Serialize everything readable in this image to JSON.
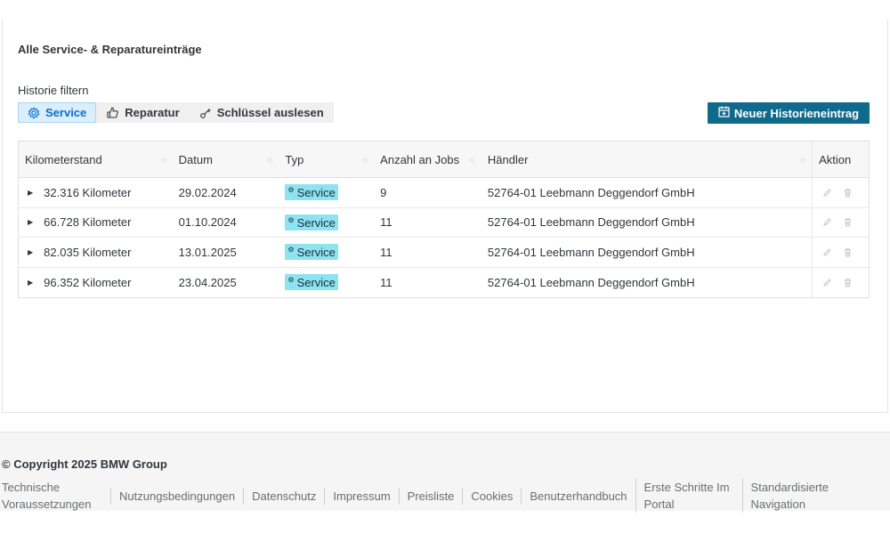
{
  "section": {
    "title": "Alle Service- & Reparatureinträge",
    "filter_label": "Historie filtern"
  },
  "filters": [
    {
      "label": "Service",
      "icon": "gear-icon",
      "active": true
    },
    {
      "label": "Reparatur",
      "icon": "thumbs-up-icon",
      "active": false
    },
    {
      "label": "Schlüssel auslesen",
      "icon": "key-icon",
      "active": false
    }
  ],
  "new_entry_button": {
    "label": "Neuer Historieneintrag",
    "icon": "calendar-add-icon"
  },
  "table": {
    "columns": [
      "Kilometerstand",
      "Datum",
      "Typ",
      "Anzahl an Jobs",
      "Händler",
      "Aktion"
    ],
    "rows": [
      {
        "km": "32.316 Kilometer",
        "date": "29.02.2024",
        "type": "Service",
        "jobs": "9",
        "dealer": "52764-01 Leebmann Deggendorf GmbH"
      },
      {
        "km": "66.728 Kilometer",
        "date": "01.10.2024",
        "type": "Service",
        "jobs": "11",
        "dealer": "52764-01 Leebmann Deggendorf GmbH"
      },
      {
        "km": "82.035 Kilometer",
        "date": "13.01.2025",
        "type": "Service",
        "jobs": "11",
        "dealer": "52764-01 Leebmann Deggendorf GmbH"
      },
      {
        "km": "96.352 Kilometer",
        "date": "23.04.2025",
        "type": "Service",
        "jobs": "11",
        "dealer": "52764-01 Leebmann Deggendorf GmbH"
      }
    ]
  },
  "footer": {
    "copyright": "© Copyright 2025 BMW Group",
    "links": [
      "Technische Voraussetzungen",
      "Nutzungsbedingungen",
      "Datenschutz",
      "Impressum",
      "Preisliste",
      "Cookies",
      "Benutzerhandbuch",
      "Erste Schritte Im Portal",
      "Standardisierte Navigation"
    ]
  },
  "colors": {
    "accent": "#0f6a8c",
    "tag": "#8de3f0",
    "active_filter": "#dbeefc"
  }
}
